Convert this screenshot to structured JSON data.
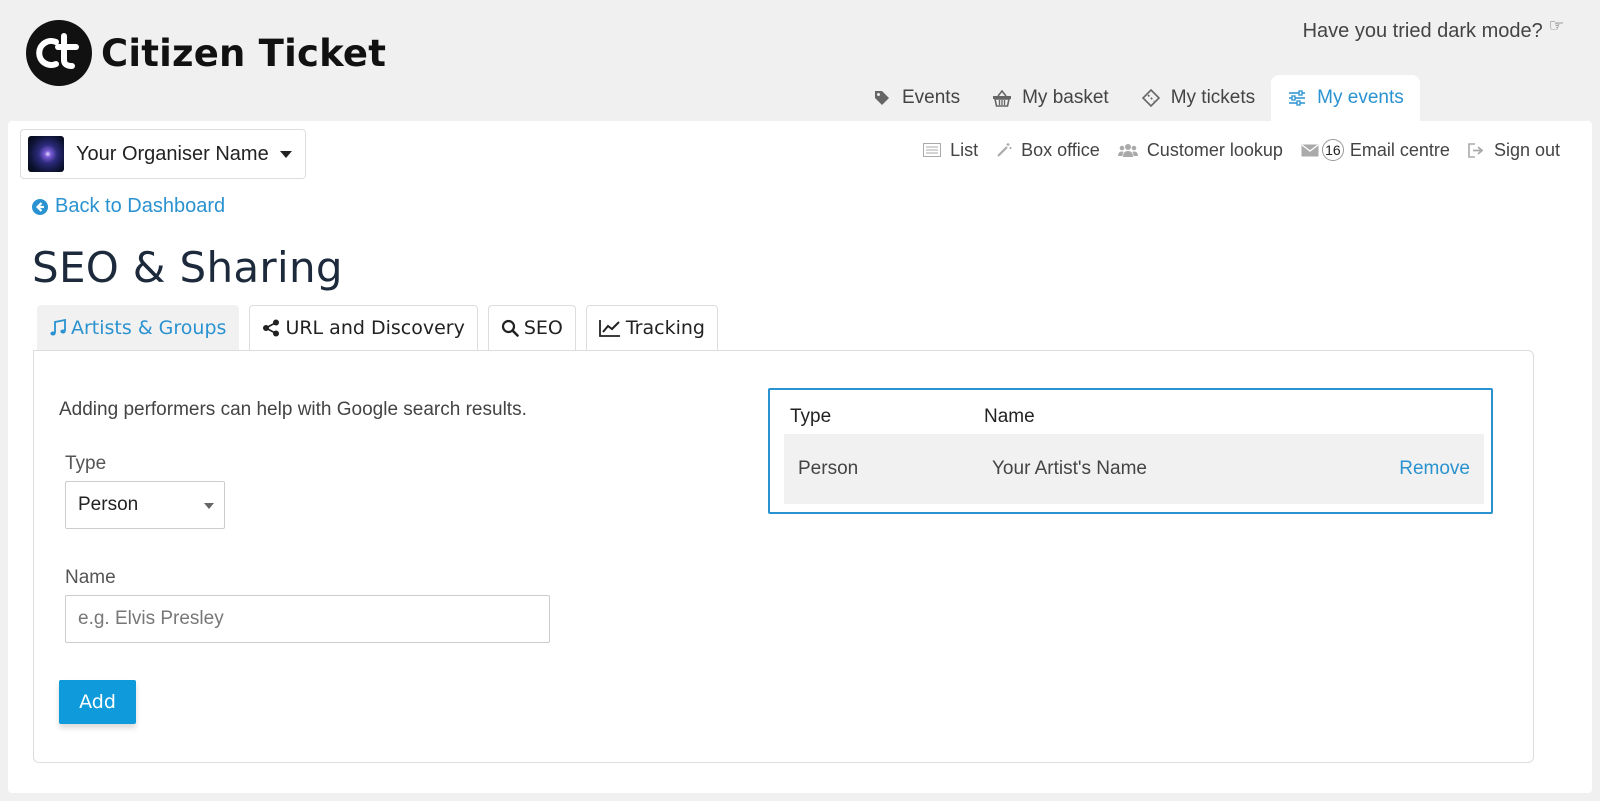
{
  "brand": {
    "name": "Citizen Ticket"
  },
  "header": {
    "dark_mode_prompt": "Have you tried dark mode?",
    "nav": [
      {
        "label": "Events",
        "icon": "tags-icon"
      },
      {
        "label": "My basket",
        "icon": "basket-icon"
      },
      {
        "label": "My tickets",
        "icon": "ticket-icon"
      },
      {
        "label": "My events",
        "icon": "sliders-icon",
        "active": true
      }
    ]
  },
  "organiser": {
    "name": "Your Organiser Name"
  },
  "subnav": {
    "list": "List",
    "box_office": "Box office",
    "customer_lookup": "Customer lookup",
    "email_badge": "16",
    "email_centre": "Email centre",
    "sign_out": "Sign out"
  },
  "back_link": "Back to Dashboard",
  "page_title": "SEO & Sharing",
  "tabs": [
    {
      "label": "Artists & Groups",
      "icon": "music-icon",
      "active": true
    },
    {
      "label": "URL and Discovery",
      "icon": "share-icon"
    },
    {
      "label": "SEO",
      "icon": "search-icon"
    },
    {
      "label": "Tracking",
      "icon": "line-chart-icon"
    }
  ],
  "form": {
    "help_text": "Adding performers can help with Google search results.",
    "type_label": "Type",
    "type_value": "Person",
    "name_label": "Name",
    "name_placeholder": "e.g. Elvis Presley",
    "add_label": "Add"
  },
  "performers": {
    "headers": {
      "type": "Type",
      "name": "Name"
    },
    "rows": [
      {
        "type": "Person",
        "name": "Your Artist's Name",
        "action": "Remove"
      }
    ]
  },
  "colors": {
    "accent": "#2a92d0",
    "button": "#0e9adb",
    "title": "#1c2a3c"
  }
}
